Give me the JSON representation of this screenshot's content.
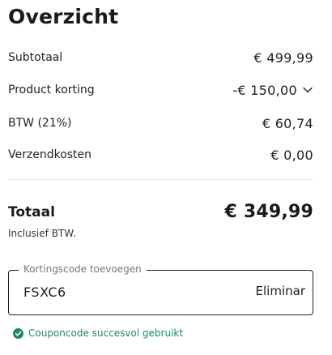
{
  "summary": {
    "title": "Overzicht",
    "rows": [
      {
        "label": "Subtotaal",
        "value": "€ 499,99"
      },
      {
        "label": "Product korting",
        "value": "-€ 150,00"
      },
      {
        "label": "BTW (21%)",
        "value": "€ 60,74"
      },
      {
        "label": "Verzendkosten",
        "value": "€ 0,00"
      }
    ],
    "total_label": "Totaal",
    "total_value": "€ 349,99",
    "vat_note": "Inclusief BTW."
  },
  "coupon": {
    "legend": "Kortingscode toevoegen",
    "value": "FSXC6",
    "remove_label": "Eliminar",
    "success_message": "Couponcode succesvol gebruikt"
  },
  "icons": {
    "discount_toggle": "chevron-down-icon",
    "success": "check-circle-icon"
  },
  "colors": {
    "success": "#1d8a5e",
    "text": "#1c1c1c"
  }
}
